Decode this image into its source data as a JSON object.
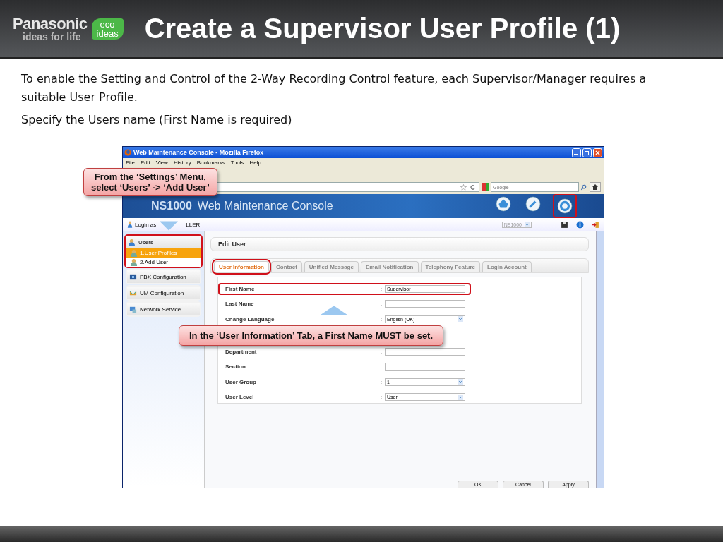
{
  "header": {
    "brand": "Panasonic",
    "tagline": "ideas for life",
    "badge": [
      "eco",
      "ideas"
    ],
    "title": "Create a Supervisor User Profile (1)"
  },
  "body": [
    "To enable the Setting and Control of the 2-Way Recording Control feature, each Supervisor/Manager requires a suitable User Profile.",
    "Specify the Users name (First Name is required)"
  ],
  "browser": {
    "title": "Web Maintenance Console - Mozilla Firefox",
    "menu": [
      "File",
      "Edit",
      "View",
      "History",
      "Bookmarks",
      "Tools",
      "Help"
    ],
    "search_placeholder": "Google"
  },
  "console": {
    "product": "NS1000",
    "name": "Web Maintenance Console",
    "login": [
      "Login as",
      "LLER"
    ],
    "site": "NS1000",
    "header_icons": [
      {
        "kind": "home",
        "highlighted": false
      },
      {
        "kind": "tools",
        "highlighted": false
      },
      {
        "kind": "settings",
        "highlighted": true
      }
    ],
    "nav": [
      {
        "label": "Users",
        "kind": "users",
        "expanded": true,
        "highlighted": true,
        "children": [
          {
            "label": "1.User Profiles",
            "selected": true
          },
          {
            "label": "2.Add User",
            "selected": false
          }
        ]
      },
      {
        "label": "PBX Configuration",
        "kind": "pbx",
        "highlighted": false
      },
      {
        "label": "UM Configuration",
        "kind": "um",
        "highlighted": false
      },
      {
        "label": "Network Service",
        "kind": "network",
        "highlighted": false
      }
    ],
    "panel_title": "Edit User",
    "separator": ":",
    "tabs": [
      {
        "label": "User Information",
        "selected": true,
        "highlighted": true
      },
      {
        "label": "Contact",
        "selected": false,
        "highlighted": false
      },
      {
        "label": "Unified Message",
        "selected": false,
        "highlighted": false
      },
      {
        "label": "Email Notification",
        "selected": false,
        "highlighted": false
      },
      {
        "label": "Telephony Feature",
        "selected": false,
        "highlighted": false
      },
      {
        "label": "Login Account",
        "selected": false,
        "highlighted": false
      }
    ],
    "fields": [
      {
        "label": "First Name",
        "kind": "text",
        "value": "Supervisor",
        "highlighted": true
      },
      {
        "label": "Last Name",
        "kind": "text",
        "highlighted": false
      },
      {
        "label": "Change Language",
        "kind": "select",
        "value": "English (UK)",
        "highlighted": false
      },
      {
        "label": "Department",
        "kind": "text",
        "highlighted": false
      },
      {
        "label": "Section",
        "kind": "text",
        "highlighted": false
      },
      {
        "label": "User Group",
        "kind": "select",
        "value": "1",
        "highlighted": false
      },
      {
        "label": "User Level",
        "kind": "select",
        "value": "User",
        "highlighted": false
      }
    ],
    "buttons": [
      "OK",
      "Cancel",
      "Apply"
    ]
  },
  "callouts": [
    {
      "lines": [
        "From the ‘Settings’ Menu,",
        "select ‘Users’ -> ‘Add User’"
      ]
    },
    {
      "lines": [
        "In the ‘User Information’ Tab, a First Name MUST be set."
      ]
    }
  ]
}
